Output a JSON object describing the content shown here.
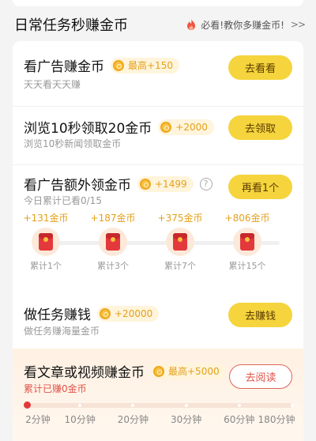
{
  "section": {
    "title": "日常任务秒赚金币",
    "link_text": "必看!教你多赚金币!",
    "link_arrows": ">>",
    "link_icon": "fire-icon"
  },
  "tasks": [
    {
      "title": "看广告赚金币",
      "reward": "最高+150",
      "subtitle": "天天看天天赚",
      "button": "去看看"
    },
    {
      "title": "浏览10秒领取20金币",
      "reward": "+2000",
      "subtitle": "浏览10秒新闻领取金币",
      "button": "去领取"
    },
    {
      "title": "看广告额外领金币",
      "reward": "+1499",
      "subtitle": "今日累计已看0/15",
      "button": "再看1个",
      "help_icon": "?",
      "milestones": [
        {
          "reward": "+131金币",
          "count": "累计1个"
        },
        {
          "reward": "+187金币",
          "count": "累计3个"
        },
        {
          "reward": "+375金币",
          "count": "累计7个"
        },
        {
          "reward": "+806金币",
          "count": "累计15个"
        }
      ]
    },
    {
      "title": "做任务赚钱",
      "reward": "+20000",
      "subtitle": "做任务赚海量金币",
      "button": "去赚钱"
    },
    {
      "title": "看文章或视频赚金币",
      "reward": "最高+5000",
      "subtitle": "累计已赚0金币",
      "button": "去阅读",
      "timeline": [
        "2分钟",
        "10分钟",
        "20分钟",
        "30分钟",
        "60分钟",
        "180分钟"
      ],
      "timeline_progress": 0
    }
  ],
  "colors": {
    "accent_yellow": "#f5d43d",
    "coin_gold": "#e4a11b",
    "accent_red": "#e4393c"
  }
}
